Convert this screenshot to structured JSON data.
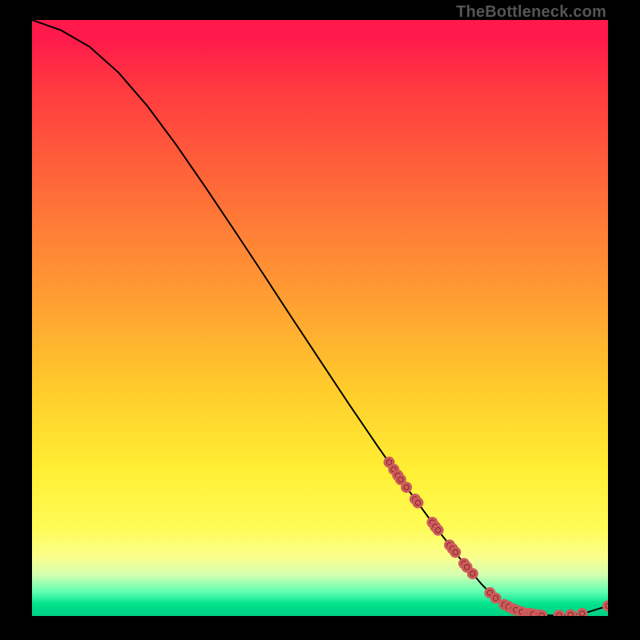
{
  "watermark": "TheBottleneck.com",
  "colors": {
    "curve_stroke": "#000000",
    "dot_fill": "#cd5c5c",
    "dot_stroke_inner": "#7f2a1f",
    "dot_stroke_outer": "#cd5c5c"
  },
  "chart_data": {
    "type": "line",
    "title": "",
    "xlabel": "",
    "ylabel": "",
    "xlim": [
      0,
      100
    ],
    "ylim": [
      0,
      100
    ],
    "series": [
      {
        "name": "bottleneck-curve",
        "x": [
          0,
          5,
          10,
          15,
          20,
          25,
          30,
          35,
          40,
          45,
          50,
          55,
          60,
          65,
          70,
          75,
          78,
          80,
          82,
          84,
          86,
          88,
          90,
          92,
          94,
          96,
          100
        ],
        "y": [
          100,
          98.3,
          95.5,
          91.2,
          85.6,
          79.1,
          72.1,
          64.9,
          57.6,
          50.2,
          42.9,
          35.6,
          28.5,
          21.6,
          15.0,
          8.8,
          5.4,
          3.4,
          1.9,
          1.0,
          0.4,
          0.2,
          0.1,
          0.1,
          0.2,
          0.5,
          1.7
        ]
      }
    ],
    "dots": {
      "name": "highlighted-points",
      "x": [
        62.0,
        62.8,
        63.5,
        64.0,
        65.0,
        66.5,
        67.0,
        69.5,
        70.0,
        70.5,
        72.5,
        73.0,
        73.5,
        75.0,
        75.5,
        76.5,
        79.5,
        80.5,
        82.0,
        82.7,
        83.5,
        84.0,
        85.0,
        86.0,
        86.5,
        87.0,
        88.0,
        88.5,
        91.5,
        93.5,
        95.5,
        100.0
      ],
      "y": [
        25.8,
        24.6,
        23.6,
        22.9,
        21.6,
        19.6,
        19.0,
        15.7,
        15.0,
        14.4,
        11.9,
        11.3,
        10.7,
        8.8,
        8.2,
        7.1,
        3.9,
        3.0,
        1.9,
        1.6,
        1.2,
        1.0,
        0.7,
        0.4,
        0.4,
        0.3,
        0.2,
        0.1,
        0.1,
        0.2,
        0.4,
        1.7
      ]
    }
  }
}
